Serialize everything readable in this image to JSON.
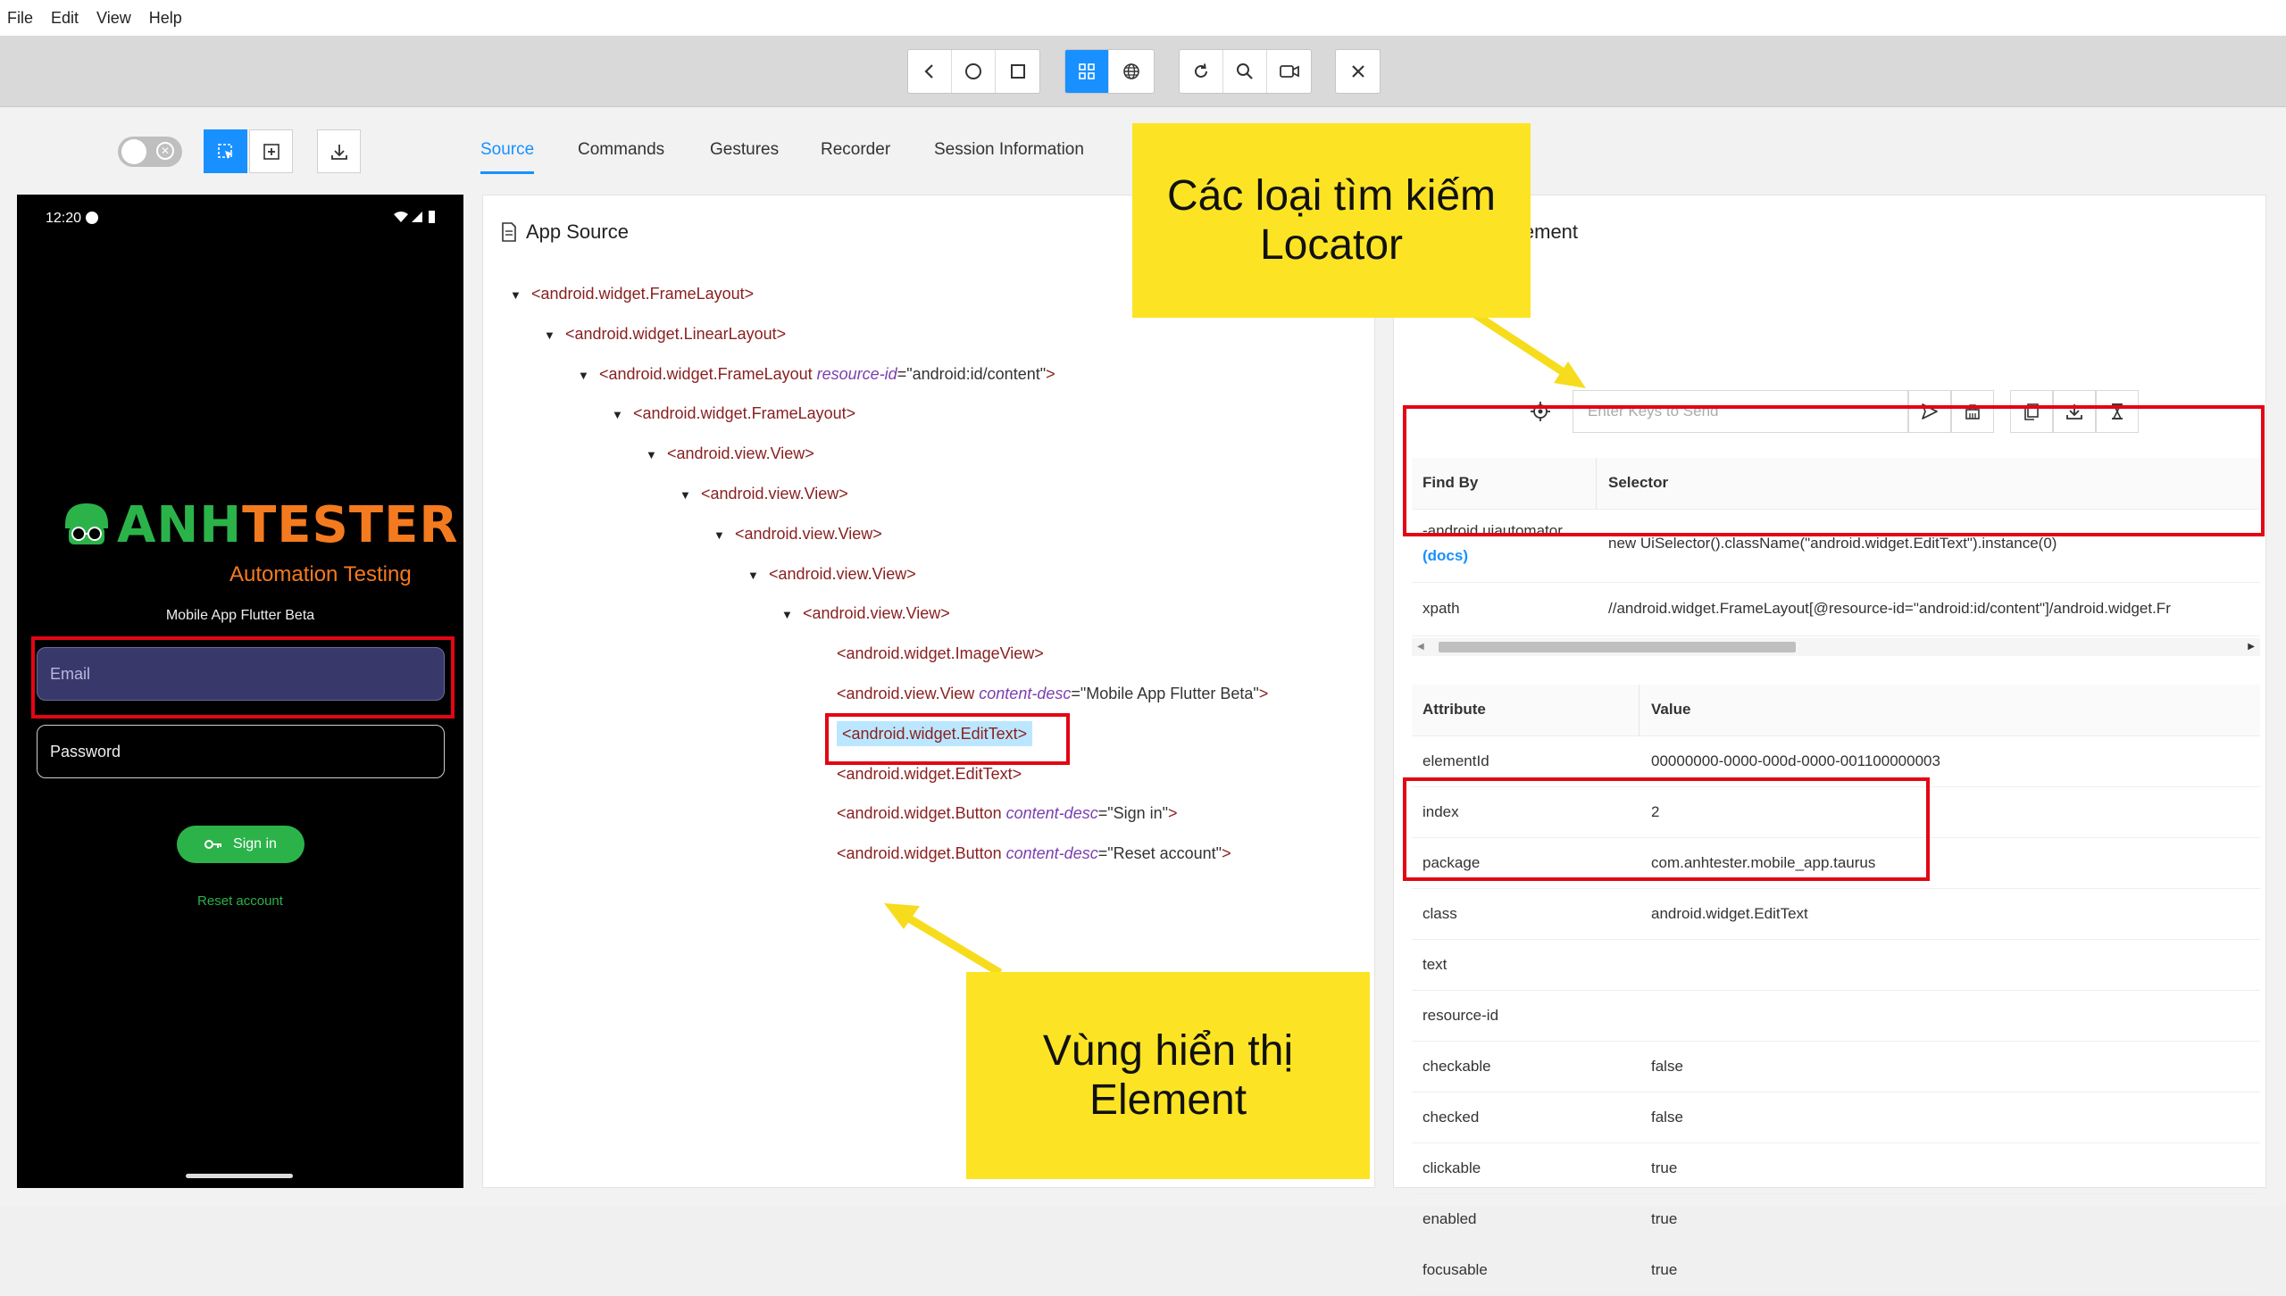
{
  "menu": [
    "File",
    "Edit",
    "View",
    "Help"
  ],
  "toolbar": {
    "nav": [
      "back-icon",
      "home-circle-icon",
      "square-icon"
    ],
    "modes": [
      "grid-icon",
      "globe-icon"
    ],
    "actions": [
      "refresh-icon",
      "search-icon",
      "record-icon"
    ],
    "quit": "close-icon"
  },
  "tabs": [
    "Source",
    "Commands",
    "Gestures",
    "Recorder",
    "Session Information"
  ],
  "phone": {
    "time": "12:20",
    "logo_left": "ANH",
    "logo_right": "TESTER",
    "logo_sub": "Automation Testing",
    "subtitle": "Mobile App Flutter Beta",
    "email_placeholder": "Email",
    "password_placeholder": "Password",
    "signin": "Sign in",
    "reset": "Reset account"
  },
  "source": {
    "title": "App Source",
    "tree": [
      {
        "depth": 0,
        "arrow": true,
        "tag": "<android.widget.FrameLayout>"
      },
      {
        "depth": 1,
        "arrow": true,
        "tag": "<android.widget.LinearLayout>"
      },
      {
        "depth": 2,
        "arrow": true,
        "tag": "<android.widget.FrameLayout ",
        "attr": "resource-id",
        "val": "\"android:id/content\"",
        "end": ">"
      },
      {
        "depth": 3,
        "arrow": true,
        "tag": "<android.widget.FrameLayout>"
      },
      {
        "depth": 4,
        "arrow": true,
        "tag": "<android.view.View>"
      },
      {
        "depth": 5,
        "arrow": true,
        "tag": "<android.view.View>"
      },
      {
        "depth": 6,
        "arrow": true,
        "tag": "<android.view.View>"
      },
      {
        "depth": 7,
        "arrow": true,
        "tag": "<android.view.View>"
      },
      {
        "depth": 8,
        "arrow": true,
        "tag": "<android.view.View>"
      },
      {
        "depth": 9,
        "arrow": false,
        "tag": "<android.widget.ImageView>"
      },
      {
        "depth": 9,
        "arrow": false,
        "tag": "<android.view.View ",
        "attr": "content-desc",
        "val": "\"Mobile App Flutter Beta\"",
        "end": ">"
      },
      {
        "depth": 9,
        "arrow": false,
        "tag": "<android.widget.EditText>",
        "selected": true
      },
      {
        "depth": 9,
        "arrow": false,
        "tag": "<android.widget.EditText>"
      },
      {
        "depth": 9,
        "arrow": false,
        "tag": "<android.widget.Button ",
        "attr": "content-desc",
        "val": "\"Sign in\"",
        "end": ">"
      },
      {
        "depth": 9,
        "arrow": false,
        "tag": "<android.widget.Button ",
        "attr": "content-desc",
        "val": "\"Reset account\"",
        "end": ">"
      }
    ]
  },
  "element": {
    "title_visible": "lement",
    "keys_placeholder": "Enter Keys to Send",
    "findby_header": [
      "Find By",
      "Selector"
    ],
    "selectors": [
      {
        "by": "-android uiautomator",
        "docs": "(docs)",
        "selector": "new UiSelector().className(\"android.widget.EditText\").instance(0)"
      },
      {
        "by": "xpath",
        "selector": "//android.widget.FrameLayout[@resource-id=\"android:id/content\"]/android.widget.Fr"
      }
    ],
    "attr_header": [
      "Attribute",
      "Value"
    ],
    "attributes": [
      [
        "elementId",
        "00000000-0000-000d-0000-001100000003"
      ],
      [
        "index",
        "2"
      ],
      [
        "package",
        "com.anhtester.mobile_app.taurus"
      ],
      [
        "class",
        "android.widget.EditText"
      ],
      [
        "text",
        ""
      ],
      [
        "resource-id",
        ""
      ],
      [
        "checkable",
        "false"
      ],
      [
        "checked",
        "false"
      ],
      [
        "clickable",
        "true"
      ],
      [
        "enabled",
        "true"
      ],
      [
        "focusable",
        "true"
      ]
    ]
  },
  "notes": {
    "locator_line1": "Các loại tìm kiếm",
    "locator_line2": "Locator",
    "element_line1": "Vùng hiển thị",
    "element_line2": "Element"
  },
  "colors": {
    "accent": "#1890ff",
    "annotation": "#fce424",
    "highlight": "#e30613",
    "brand_green": "#2bb34a",
    "brand_orange": "#f47a1f"
  }
}
